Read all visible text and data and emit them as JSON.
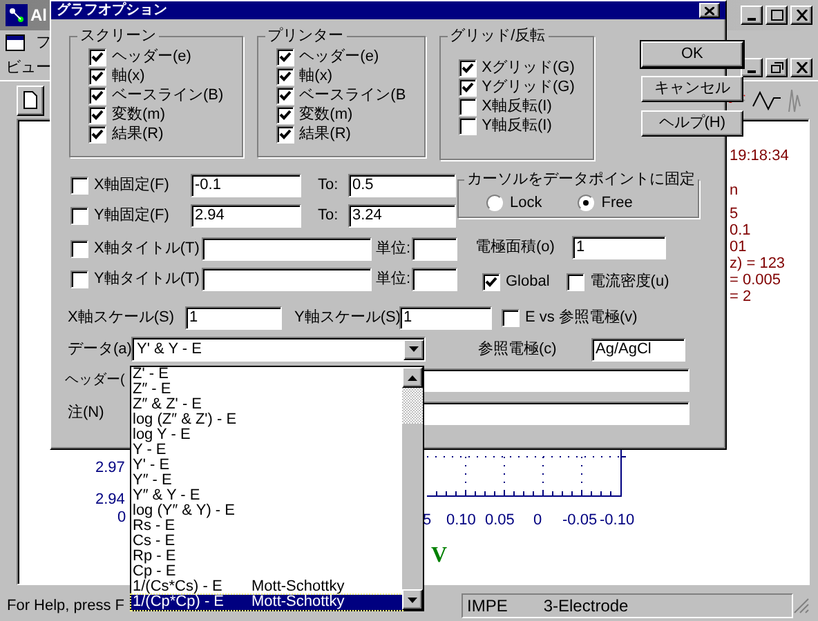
{
  "app": {
    "title": "Al",
    "menu": [
      {
        "label": "フ"
      },
      {
        "label": "ビュー"
      }
    ]
  },
  "plot": {
    "time": "19:18:34",
    "info_lines": [
      "n",
      "5",
      "0.1",
      "01",
      "z) = 123",
      "= 0.005",
      "= 2"
    ],
    "y_labels": [
      "2.97",
      "2.94",
      "0"
    ],
    "x_labels": [
      "5",
      "0.10",
      "0.05",
      "0",
      "-0.05",
      "-0.10"
    ],
    "x_unit": "V"
  },
  "status_bar": {
    "help": "For Help, press F",
    "panels": [
      "IMPE",
      "3-Electrode"
    ]
  },
  "dialog": {
    "title": "グラフオプション",
    "groups": [
      {
        "title": "スクリーン",
        "items": [
          {
            "label": "ヘッダー(e)",
            "checked": true
          },
          {
            "label": "軸(x)",
            "checked": true
          },
          {
            "label": "ベースライン(B)",
            "checked": true
          },
          {
            "label": "変数(m)",
            "checked": true
          },
          {
            "label": "結果(R)",
            "checked": true
          }
        ]
      },
      {
        "title": "プリンター",
        "items": [
          {
            "label": "ヘッダー(e)",
            "checked": true
          },
          {
            "label": "軸(x)",
            "checked": true
          },
          {
            "label": "ベースライン(B",
            "checked": true
          },
          {
            "label": "変数(m)",
            "checked": true
          },
          {
            "label": "結果(R)",
            "checked": true
          }
        ]
      },
      {
        "title": "グリッド/反転",
        "items": [
          {
            "label": "Xグリッド(G)",
            "checked": true
          },
          {
            "label": "Yグリッド(G)",
            "checked": true
          },
          {
            "label": "X軸反転(I)",
            "checked": false
          },
          {
            "label": "Y軸反転(I)",
            "checked": false
          }
        ]
      }
    ],
    "buttons": [
      {
        "label": "OK",
        "default": true
      },
      {
        "label": "キャンセル",
        "default": false
      },
      {
        "label": "ヘルプ(H)",
        "default": false
      }
    ],
    "axis_rows": [
      {
        "kind": "range",
        "label": "X軸固定(F)",
        "checked": false,
        "from": "-0.1",
        "to_label": "To:",
        "to": "0.5"
      },
      {
        "kind": "range",
        "label": "Y軸固定(F)",
        "checked": false,
        "from": "2.94",
        "to_label": "To:",
        "to": "3.24"
      },
      {
        "kind": "title",
        "label": "X軸タイトル(T)",
        "checked": false,
        "unit_label": "単位:"
      },
      {
        "kind": "title",
        "label": "Y軸タイトル(T)",
        "checked": false,
        "unit_label": "単位:"
      }
    ],
    "cursor_lock": {
      "title": "カーソルをデータポイントに固定",
      "options": [
        {
          "label": "Lock",
          "selected": false
        },
        {
          "label": "Free",
          "selected": true
        }
      ]
    },
    "electrode_area": {
      "label": "電極面積(o)",
      "value": "1"
    },
    "global": {
      "label": "Global",
      "checked": true
    },
    "current_density": {
      "label": "電流密度(u)",
      "checked": false
    },
    "x_scale": {
      "label": "X軸スケール(S)",
      "value": "1"
    },
    "y_scale": {
      "label": "Y軸スケール(S)",
      "value": "1"
    },
    "e_vs_ref": {
      "label": "E vs 参照電極(v)",
      "checked": false
    },
    "data": {
      "label": "データ(a)",
      "value": "Y' & Y - E",
      "options": [
        {
          "label": "Z' - E",
          "selected": false
        },
        {
          "label": "Z″ - E",
          "selected": false
        },
        {
          "label": "Z″ & Z' - E",
          "selected": false
        },
        {
          "label": "log (Z″ & Z') - E",
          "selected": false
        },
        {
          "label": "log Y - E",
          "selected": false
        },
        {
          "label": "Y - E",
          "selected": false
        },
        {
          "label": "Y' - E",
          "selected": false
        },
        {
          "label": "Y″ - E",
          "selected": false
        },
        {
          "label": "Y″ & Y - E",
          "selected": false
        },
        {
          "label": "log (Y″ & Y) - E",
          "selected": false
        },
        {
          "label": "Rs - E",
          "selected": false
        },
        {
          "label": "Cs - E",
          "selected": false
        },
        {
          "label": "Rp - E",
          "selected": false
        },
        {
          "label": "Cp - E",
          "selected": false
        },
        {
          "label": "1/(Cs*Cs) - E",
          "note": "Mott-Schottky",
          "selected": false
        },
        {
          "label": "1/(Cp*Cp) - E",
          "note": "Mott-Schottky",
          "selected": true
        }
      ]
    },
    "reference": {
      "label": "参照電極(c)",
      "value": "Ag/AgCl"
    },
    "header": {
      "label": "ヘッダー("
    },
    "note": {
      "label": "注(N)"
    }
  }
}
